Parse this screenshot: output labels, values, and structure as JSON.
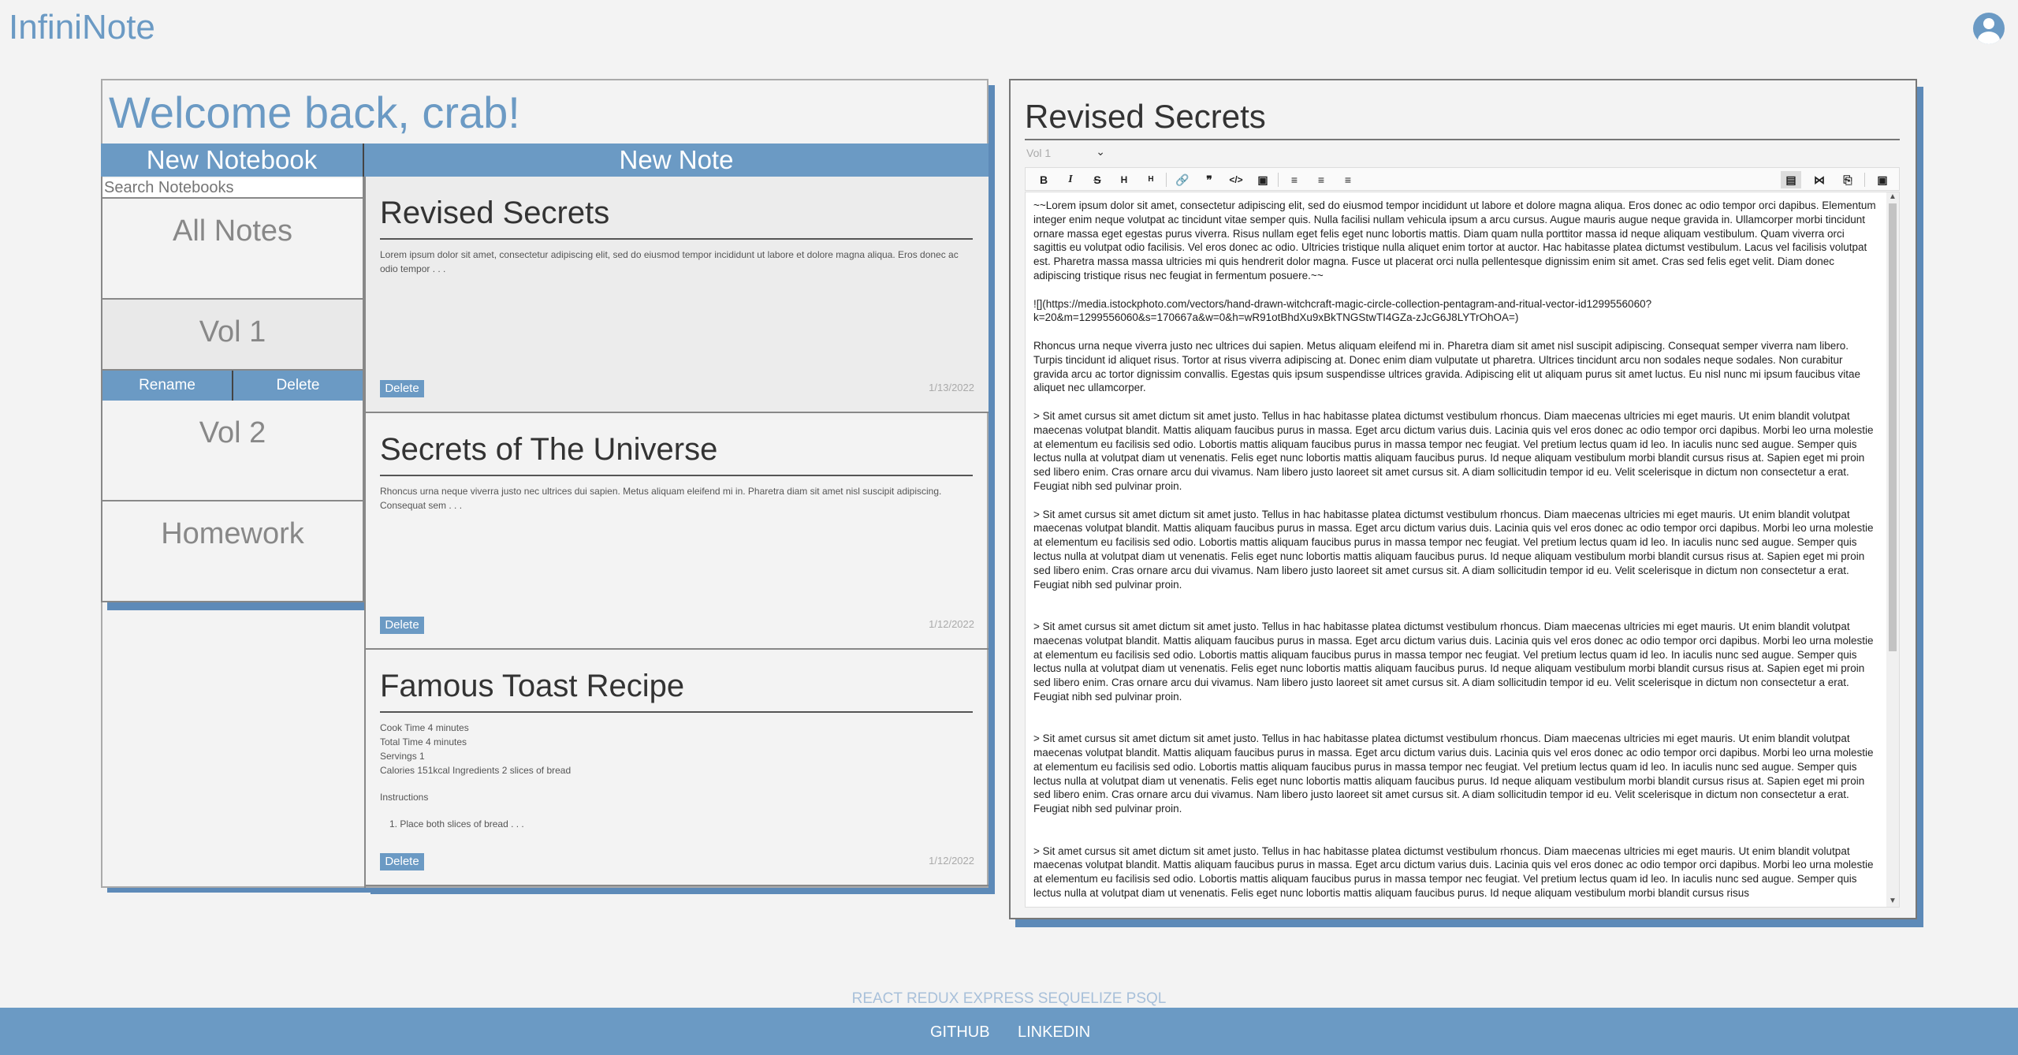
{
  "app": {
    "title": "InfiniNote"
  },
  "header": {
    "avatar_icon": "user-circle-icon"
  },
  "welcome": "Welcome back, crab!",
  "new_notebook_label": "New Notebook",
  "new_note_label": "New Note",
  "notebook_search": {
    "placeholder": "Search Notebooks"
  },
  "notebooks": [
    {
      "name": "All Notes"
    },
    {
      "name": "Vol 1"
    },
    {
      "name": "Vol 2"
    },
    {
      "name": "Homework"
    }
  ],
  "notebook_actions": {
    "rename": "Rename",
    "delete": "Delete"
  },
  "notes": [
    {
      "title": "Revised Secrets",
      "preview": "Lorem ipsum dolor sit amet, consectetur adipiscing elit, sed do eiusmod tempor incididunt ut labore et dolore magna aliqua. Eros donec ac odio tempor . . .",
      "delete_label": "Delete",
      "date": "1/13/2022"
    },
    {
      "title": "Secrets of The Universe",
      "preview": "Rhoncus urna neque viverra justo nec ultrices dui sapien. Metus aliquam eleifend mi in. Pharetra diam sit amet nisl suscipit adipiscing. Consequat sem . . .",
      "delete_label": "Delete",
      "date": "1/12/2022"
    },
    {
      "title": "Famous Toast Recipe",
      "lines": [
        "Cook Time 4 minutes",
        "Total Time 4 minutes",
        "Servings 1",
        "Calories 151kcal Ingredients 2 slices of bread"
      ],
      "instructions_label": "Instructions",
      "step": "1. Place both slices of bread . . .",
      "delete_label": "Delete",
      "date": "1/12/2022"
    }
  ],
  "editor": {
    "title": "Revised Secrets",
    "notebook_select": "Vol 1",
    "toolbar": [
      "B",
      "I",
      "S",
      "H",
      "H",
      "link",
      "quote",
      "code",
      "image",
      "ul",
      "ol",
      "check",
      "preview",
      "side-by-side",
      "fullscreen",
      "expand"
    ],
    "content": "~~Lorem ipsum dolor sit amet, consectetur adipiscing elit, sed do eiusmod tempor incididunt ut labore et dolore magna aliqua. Eros donec ac odio tempor orci dapibus. Elementum integer enim neque volutpat ac tincidunt vitae semper quis. Nulla facilisi nullam vehicula ipsum a arcu cursus. Augue mauris augue neque gravida in. Ullamcorper morbi tincidunt ornare massa eget egestas purus viverra. Risus nullam eget felis eget nunc lobortis mattis. Diam quam nulla porttitor massa id neque aliquam vestibulum. Quam viverra orci sagittis eu volutpat odio facilisis. Vel eros donec ac odio. Ultricies tristique nulla aliquet enim tortor at auctor. Hac habitasse platea dictumst vestibulum. Lacus vel facilisis volutpat est. Pharetra massa massa ultricies mi quis hendrerit dolor magna. Fusce ut placerat orci nulla pellentesque dignissim enim sit amet. Cras sed felis eget velit. Diam donec adipiscing tristique risus nec feugiat in fermentum posuere.~~\n\n![](https://media.istockphoto.com/vectors/hand-drawn-witchcraft-magic-circle-collection-pentagram-and-ritual-vector-id1299556060?k=20&m=1299556060&s=170667a&w=0&h=wR91otBhdXu9xBkTNGStwTI4GZa-zJcG6J8LYTrOhOA=)\n\nRhoncus urna neque viverra justo nec ultrices dui sapien. Metus aliquam eleifend mi in. Pharetra diam sit amet nisl suscipit adipiscing. Consequat semper viverra nam libero. Turpis tincidunt id aliquet risus. Tortor at risus viverra adipiscing at. Donec enim diam vulputate ut pharetra. Ultrices tincidunt arcu non sodales neque sodales. Non curabitur gravida arcu ac tortor dignissim convallis. Egestas quis ipsum suspendisse ultrices gravida. Adipiscing elit ut aliquam purus sit amet luctus. Eu nisl nunc mi ipsum faucibus vitae aliquet nec ullamcorper.\n\n> Sit amet cursus sit amet dictum sit amet justo. Tellus in hac habitasse platea dictumst vestibulum rhoncus. Diam maecenas ultricies mi eget mauris. Ut enim blandit volutpat maecenas volutpat blandit. Mattis aliquam faucibus purus in massa. Eget arcu dictum varius duis. Lacinia quis vel eros donec ac odio tempor orci dapibus. Morbi leo urna molestie at elementum eu facilisis sed odio. Lobortis mattis aliquam faucibus purus in massa tempor nec feugiat. Vel pretium lectus quam id leo. In iaculis nunc sed augue. Semper quis lectus nulla at volutpat diam ut venenatis. Felis eget nunc lobortis mattis aliquam faucibus purus. Id neque aliquam vestibulum morbi blandit cursus risus at. Sapien eget mi proin sed libero enim. Cras ornare arcu dui vivamus. Nam libero justo laoreet sit amet cursus sit. A diam sollicitudin tempor id eu. Velit scelerisque in dictum non consectetur a erat. Feugiat nibh sed pulvinar proin.\n\n> Sit amet cursus sit amet dictum sit amet justo. Tellus in hac habitasse platea dictumst vestibulum rhoncus. Diam maecenas ultricies mi eget mauris. Ut enim blandit volutpat maecenas volutpat blandit. Mattis aliquam faucibus purus in massa. Eget arcu dictum varius duis. Lacinia quis vel eros donec ac odio tempor orci dapibus. Morbi leo urna molestie at elementum eu facilisis sed odio. Lobortis mattis aliquam faucibus purus in massa tempor nec feugiat. Vel pretium lectus quam id leo. In iaculis nunc sed augue. Semper quis lectus nulla at volutpat diam ut venenatis. Felis eget nunc lobortis mattis aliquam faucibus purus. Id neque aliquam vestibulum morbi blandit cursus risus at. Sapien eget mi proin sed libero enim. Cras ornare arcu dui vivamus. Nam libero justo laoreet sit amet cursus sit. A diam sollicitudin tempor id eu. Velit scelerisque in dictum non consectetur a erat. Feugiat nibh sed pulvinar proin.\n\n\n> Sit amet cursus sit amet dictum sit amet justo. Tellus in hac habitasse platea dictumst vestibulum rhoncus. Diam maecenas ultricies mi eget mauris. Ut enim blandit volutpat maecenas volutpat blandit. Mattis aliquam faucibus purus in massa. Eget arcu dictum varius duis. Lacinia quis vel eros donec ac odio tempor orci dapibus. Morbi leo urna molestie at elementum eu facilisis sed odio. Lobortis mattis aliquam faucibus purus in massa tempor nec feugiat. Vel pretium lectus quam id leo. In iaculis nunc sed augue. Semper quis lectus nulla at volutpat diam ut venenatis. Felis eget nunc lobortis mattis aliquam faucibus purus. Id neque aliquam vestibulum morbi blandit cursus risus at. Sapien eget mi proin sed libero enim. Cras ornare arcu dui vivamus. Nam libero justo laoreet sit amet cursus sit. A diam sollicitudin tempor id eu. Velit scelerisque in dictum non consectetur a erat. Feugiat nibh sed pulvinar proin.\n\n\n> Sit amet cursus sit amet dictum sit amet justo. Tellus in hac habitasse platea dictumst vestibulum rhoncus. Diam maecenas ultricies mi eget mauris. Ut enim blandit volutpat maecenas volutpat blandit. Mattis aliquam faucibus purus in massa. Eget arcu dictum varius duis. Lacinia quis vel eros donec ac odio tempor orci dapibus. Morbi leo urna molestie at elementum eu facilisis sed odio. Lobortis mattis aliquam faucibus purus in massa tempor nec feugiat. Vel pretium lectus quam id leo. In iaculis nunc sed augue. Semper quis lectus nulla at volutpat diam ut venenatis. Felis eget nunc lobortis mattis aliquam faucibus purus. Id neque aliquam vestibulum morbi blandit cursus risus at. Sapien eget mi proin sed libero enim. Cras ornare arcu dui vivamus. Nam libero justo laoreet sit amet cursus sit. A diam sollicitudin tempor id eu. Velit scelerisque in dictum non consectetur a erat. Feugiat nibh sed pulvinar proin.\n\n\n> Sit amet cursus sit amet dictum sit amet justo. Tellus in hac habitasse platea dictumst vestibulum rhoncus. Diam maecenas ultricies mi eget mauris. Ut enim blandit volutpat maecenas volutpat blandit. Mattis aliquam faucibus purus in massa. Eget arcu dictum varius duis. Lacinia quis vel eros donec ac odio tempor orci dapibus. Morbi leo urna molestie at elementum eu facilisis sed odio. Lobortis mattis aliquam faucibus purus in massa tempor nec feugiat. Vel pretium lectus quam id leo. In iaculis nunc sed augue. Semper quis lectus nulla at volutpat diam ut venenatis. Felis eget nunc lobortis mattis aliquam faucibus purus. Id neque aliquam vestibulum morbi blandit cursus risus"
  },
  "footer": {
    "tech": "REACT REDUX EXPRESS SEQUELIZE PSQL",
    "github": "GITHUB",
    "linkedin": "LINKEDIN"
  },
  "colors": {
    "accent": "#6b9ac4",
    "shadow": "#5d8ab8"
  }
}
